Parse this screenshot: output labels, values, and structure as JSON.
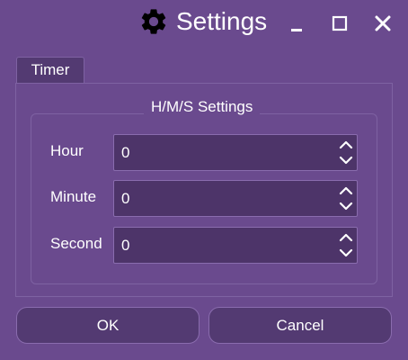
{
  "window": {
    "title": "Settings",
    "icon": "gear-icon"
  },
  "controls": {
    "minimize": "minimize-icon",
    "maximize": "maximize-icon",
    "close": "close-icon"
  },
  "tabs": [
    {
      "label": "Timer",
      "selected": true
    }
  ],
  "group": {
    "title": "H/M/S Settings",
    "fields": [
      {
        "label": "Hour",
        "value": "0"
      },
      {
        "label": "Minute",
        "value": "0"
      },
      {
        "label": "Second",
        "value": "0"
      }
    ]
  },
  "buttons": {
    "ok": "OK",
    "cancel": "Cancel"
  },
  "colors": {
    "background": "#6a4a8e",
    "input": "#4d3469",
    "border": "#8a6cae",
    "button": "#533a72"
  }
}
